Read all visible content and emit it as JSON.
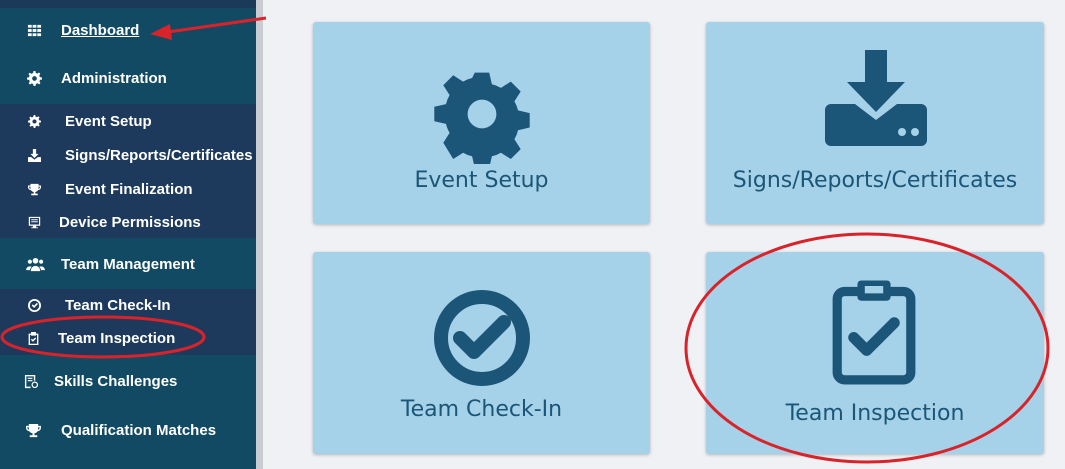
{
  "sidebar": {
    "items": [
      {
        "label": "Dashboard",
        "icon": "grid-icon"
      },
      {
        "label": "Administration",
        "icon": "gear-icon"
      },
      {
        "label": "Team Management",
        "icon": "users-icon"
      },
      {
        "label": "Skills Challenges",
        "icon": "skills-icon"
      },
      {
        "label": "Qualification Matches",
        "icon": "trophy-icon"
      }
    ],
    "admin_sub": [
      {
        "label": "Event Setup",
        "icon": "gear-icon"
      },
      {
        "label": "Signs/Reports/Certificates",
        "icon": "download-icon"
      },
      {
        "label": "Event Finalization",
        "icon": "trophy-icon"
      },
      {
        "label": "Device Permissions",
        "icon": "device-icon"
      }
    ],
    "team_sub": [
      {
        "label": "Team Check-In",
        "icon": "check-circle-icon"
      },
      {
        "label": "Team Inspection",
        "icon": "clipboard-check-icon"
      }
    ]
  },
  "tiles": [
    {
      "label": "Event Setup",
      "icon": "gear-icon"
    },
    {
      "label": "Signs/Reports/Certificates",
      "icon": "download-icon"
    },
    {
      "label": "Team Check-In",
      "icon": "check-circle-icon"
    },
    {
      "label": "Team Inspection",
      "icon": "clipboard-check-icon"
    }
  ],
  "colors": {
    "sidebar_bg": "#124a63",
    "submenu_bg": "#1d3a5d",
    "tile_bg": "#a5d2e8",
    "tile_icon": "#1b5577",
    "annotation_red": "#d9232a"
  }
}
